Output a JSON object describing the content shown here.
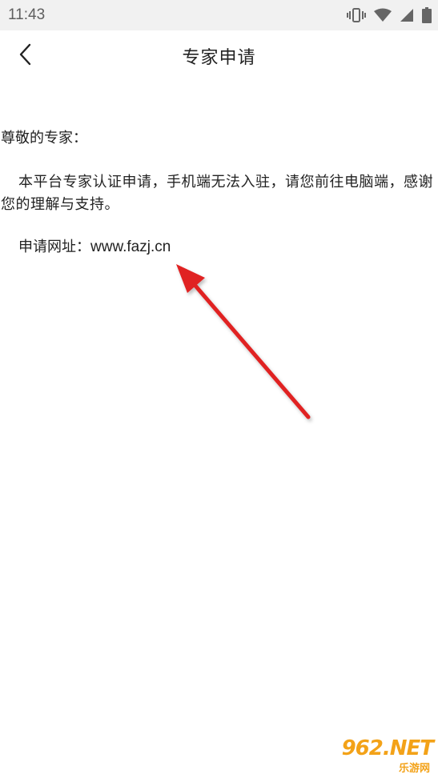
{
  "status_bar": {
    "time": "11:43",
    "icons": [
      "vibrate-icon",
      "wifi-icon",
      "signal-icon",
      "battery-icon"
    ]
  },
  "app_bar": {
    "title": "专家申请",
    "back_icon": "chevron-left-icon"
  },
  "content": {
    "greeting": "尊敬的专家：",
    "notice": "本平台专家认证申请，手机端无法入驻，请您前往电脑端，感谢您的理解与支持。",
    "url_label": "申请网址：",
    "url": "www.fazj.cn"
  },
  "watermark": {
    "main": "962.NET",
    "sub": "乐游网"
  },
  "colors": {
    "arrow": "#e02020",
    "status_bar_bg": "#f1f1f1",
    "watermark": "#f3a218"
  }
}
